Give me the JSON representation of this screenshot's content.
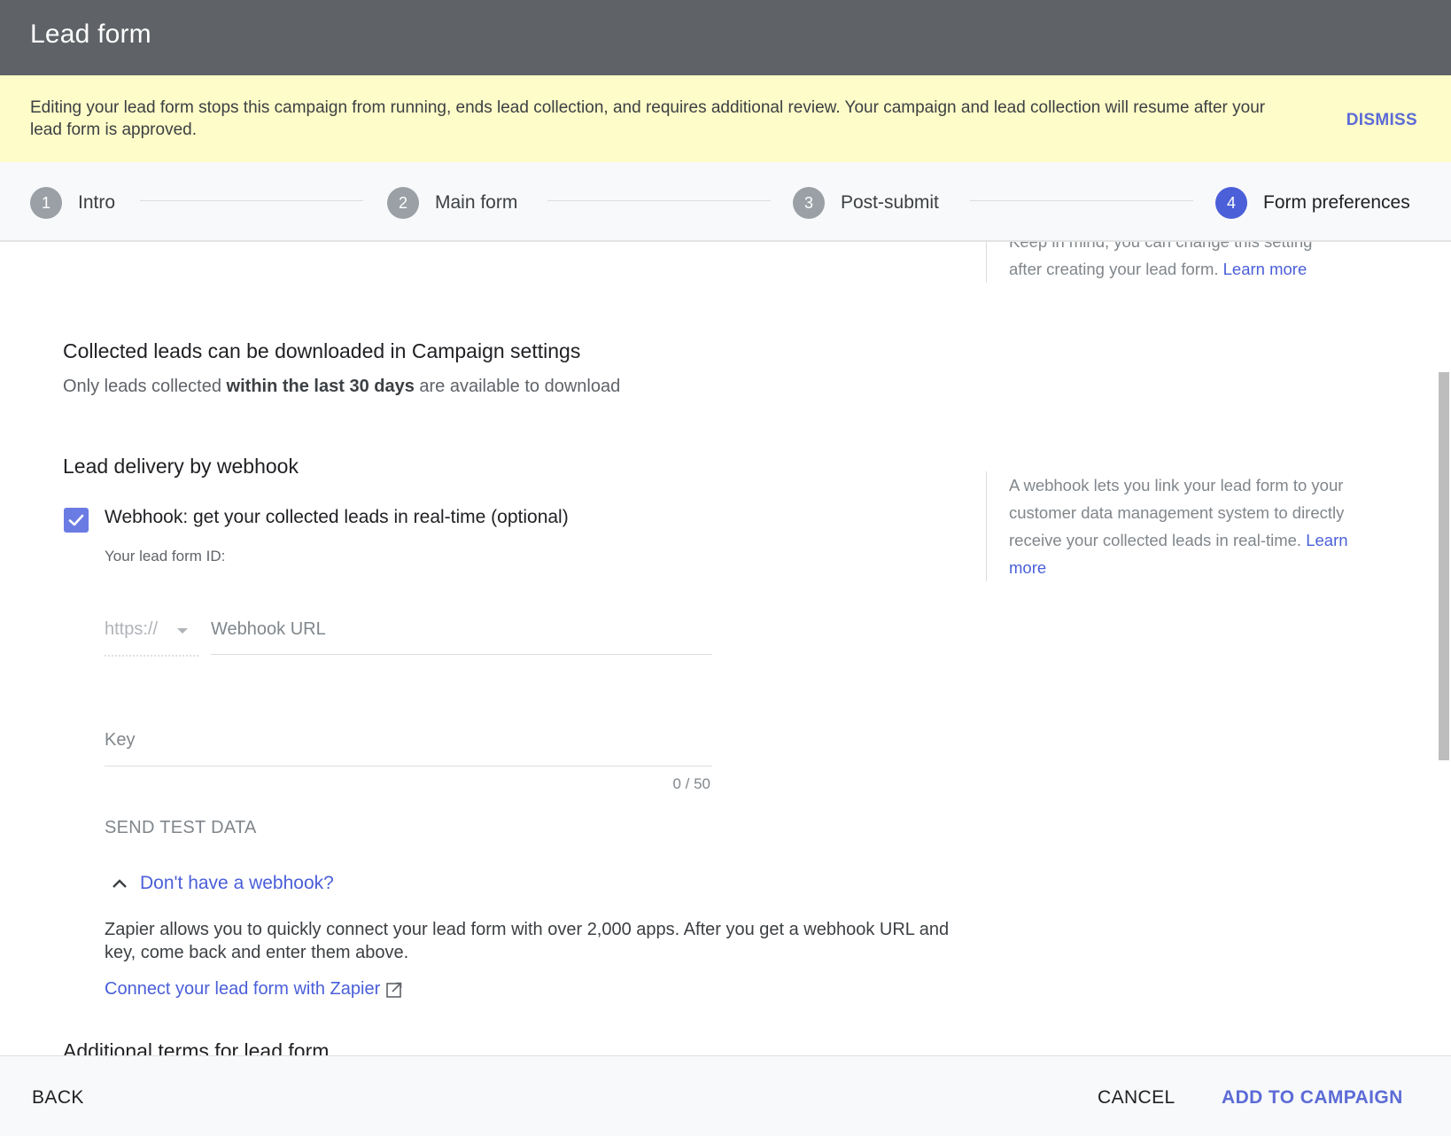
{
  "dialog": {
    "title": "Lead form"
  },
  "banner": {
    "message": "Editing your lead form stops this campaign from running, ends lead collection, and requires additional review. Your campaign and lead collection will resume after your lead form is approved.",
    "dismiss_label": "DISMISS"
  },
  "stepper": {
    "steps": [
      {
        "number": "1",
        "label": "Intro",
        "active": false
      },
      {
        "number": "2",
        "label": "Main form",
        "active": false
      },
      {
        "number": "3",
        "label": "Post-submit",
        "active": false
      },
      {
        "number": "4",
        "label": "Form preferences",
        "active": true
      }
    ]
  },
  "top_note": {
    "line1": "Keep in mind, you can change this setting",
    "line2": "after creating your lead form.",
    "link": "Learn more"
  },
  "download_section": {
    "heading": "Collected leads can be downloaded in Campaign settings",
    "sub_prefix": "Only leads collected ",
    "sub_bold": "within the last 30 days",
    "sub_suffix": " are available to download"
  },
  "webhook_section": {
    "heading": "Lead delivery by webhook",
    "checkbox_label": "Webhook: get your collected leads in real-time (optional)",
    "checkbox_checked": true,
    "lead_form_id_label": "Your lead form ID:",
    "protocol_select": {
      "value": "https://",
      "icon": "arrow-drop-down-icon"
    },
    "webhook_url": {
      "placeholder": "Webhook URL",
      "value": ""
    },
    "key": {
      "placeholder": "Key",
      "value": "",
      "counter": "0 / 50"
    },
    "send_test_label": "SEND TEST DATA",
    "no_webhook": {
      "toggle_label": "Don't have a webhook?",
      "icon": "chevron-up-icon",
      "description": "Zapier allows you to quickly connect your lead form with over 2,000 apps. After you get a webhook URL and key, come back and enter them above.",
      "zapier_link": "Connect your lead form with Zapier",
      "zapier_icon": "open-in-new-icon"
    },
    "side_note": {
      "text": "A webhook lets you link your lead form to your customer data management system to directly receive your collected leads in real-time.",
      "link": "Learn more"
    }
  },
  "next_section": {
    "heading": "Additional terms for lead form"
  },
  "footer": {
    "back_label": "BACK",
    "cancel_label": "CANCEL",
    "add_label": "ADD TO CAMPAIGN"
  },
  "colors": {
    "header_bg": "#5f6368",
    "banner_bg": "#fefcc8",
    "accent": "#4a5fd8",
    "checkbox": "#6b7be4"
  }
}
